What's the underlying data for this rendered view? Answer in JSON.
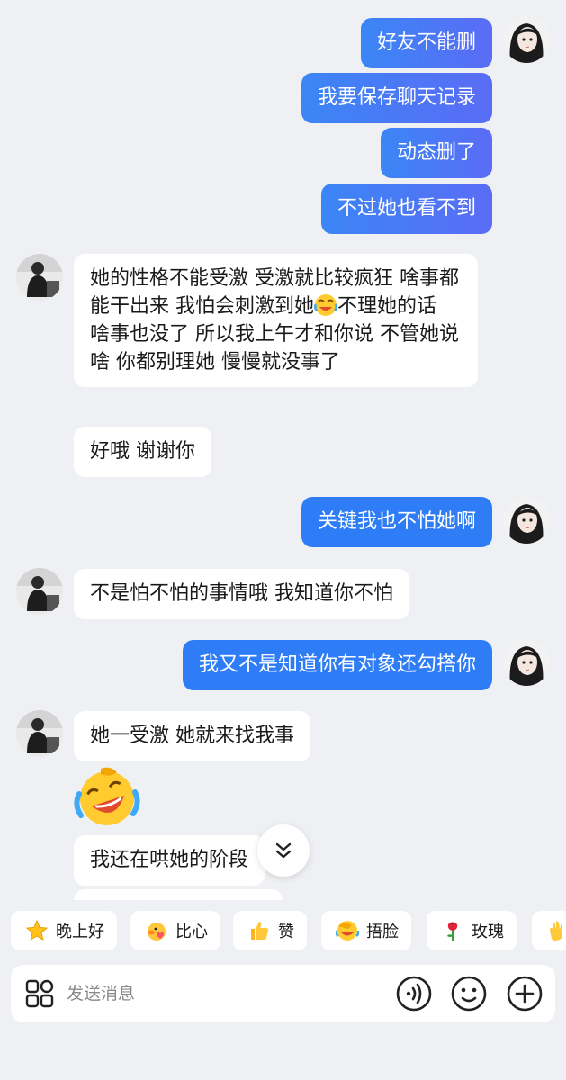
{
  "messages": [
    {
      "sender": "me",
      "text": "好友不能删"
    },
    {
      "sender": "me",
      "text": "我要保存聊天记录"
    },
    {
      "sender": "me",
      "text": "动态删了"
    },
    {
      "sender": "me",
      "text": "不过她也看不到"
    },
    {
      "sender": "them",
      "text_before_emoji": "她的性格不能受激 受激就比较疯狂 啥事都能干出来 我怕会刺激到她",
      "emoji": "rofl-emoji",
      "text_after_emoji": "不理她的话 啥事也没了 所以我上午才和你说 不管她说啥 你都别理她 慢慢就没事了"
    },
    {
      "sender": "them",
      "text": "好哦 谢谢你"
    },
    {
      "sender": "me",
      "text": "关键我也不怕她啊"
    },
    {
      "sender": "them",
      "text": "不是怕不怕的事情哦 我知道你不怕"
    },
    {
      "sender": "me",
      "text": "我又不是知道你有对象还勾搭你"
    },
    {
      "sender": "them",
      "text": "她一受激 她就来找我事"
    },
    {
      "sender": "them",
      "sticker": "rofl-emoji"
    },
    {
      "sender": "them",
      "text": "我还在哄她的阶段"
    }
  ],
  "quick_replies": [
    {
      "icon": "star-icon",
      "label": "晚上好"
    },
    {
      "icon": "duck-heart-icon",
      "label": "比心"
    },
    {
      "icon": "thumbs-up-icon",
      "label": "赞"
    },
    {
      "icon": "facepalm-icon",
      "label": "捂脸"
    },
    {
      "icon": "rose-icon",
      "label": "玫瑰"
    },
    {
      "icon": "clap-icon",
      "label": ""
    }
  ],
  "input": {
    "placeholder": "发送消息"
  },
  "colors": {
    "outgoing_gradient_start": "#3b86f6",
    "outgoing_gradient_end": "#5a6cf5",
    "incoming_bubble": "#ffffff",
    "background": "#eef0f3"
  }
}
